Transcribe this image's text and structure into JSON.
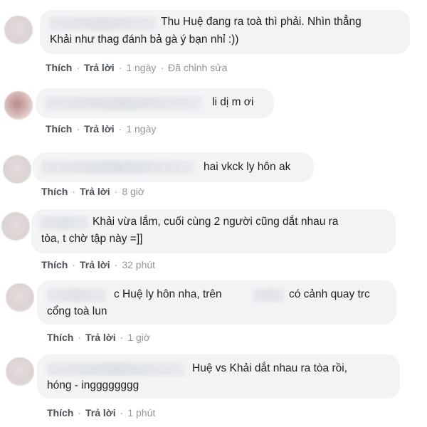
{
  "comments": [
    {
      "lines": [
        "Thu Huệ đang ra toà thì phải. Nhìn thẳng",
        "Khải như thag đánh bả gà ý bạn nhỉ :))"
      ],
      "like": "Thích",
      "reply": "Trả lời",
      "time": "1 ngày",
      "edited": "Đã chỉnh sửa"
    },
    {
      "lines": [
        "li dị m ơi"
      ],
      "like": "Thích",
      "reply": "Trả lời",
      "time": "1 ngày"
    },
    {
      "lines": [
        "hai vkck ly hôn ak"
      ],
      "like": "Thích",
      "reply": "Trả lời",
      "time": "8 giờ"
    },
    {
      "lines": [
        "Khải vừa lắm, cuối cùng 2 người cũng dắt nhau ra",
        "tòa, t chờ tập này =]]"
      ],
      "like": "Thích",
      "reply": "Trả lời",
      "time": "32 phút"
    },
    {
      "lines": [
        "c Huệ ly hôn nha, trên",
        "có cảnh quay trc",
        "cổng toà lun"
      ],
      "like": "Thích",
      "reply": "Trả lời",
      "time": "1 giờ"
    },
    {
      "lines": [
        "Huệ vs Khải dắt nhau ra tòa rồi,",
        "hóng - ingggggggg"
      ],
      "like": "Thích",
      "reply": "Trả lời",
      "time": "1 phút"
    }
  ]
}
